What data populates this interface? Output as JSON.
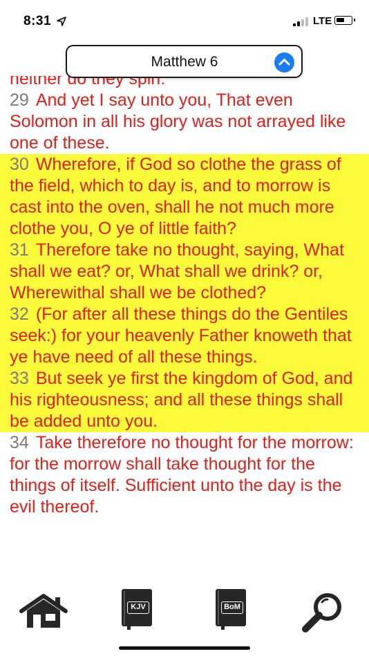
{
  "status_bar": {
    "time": "8:31",
    "network": "LTE"
  },
  "header": {
    "chapter": "Matthew 6"
  },
  "verses": [
    {
      "num": "",
      "text": "neither do they spin:",
      "highlighted": false
    },
    {
      "num": "29",
      "text": "And yet I say unto you, That even Solomon in all his glory was not arrayed like one of these.",
      "highlighted": false
    },
    {
      "num": "30",
      "text": "Wherefore, if God so clothe the grass of the field, which to day is, and to morrow is cast into the oven, shall he not much more clothe you, O ye of little faith?",
      "highlighted": true
    },
    {
      "num": "31",
      "text": "Therefore take no thought, saying, What shall we eat? or, What shall we drink? or, Wherewithal shall we be clothed?",
      "highlighted": true
    },
    {
      "num": "32",
      "text": "(For after all these things do the Gentiles seek:) for your heavenly Father knoweth that ye have need of all these things.",
      "highlighted": true
    },
    {
      "num": "33",
      "text": "But seek ye first the kingdom of God, and his righteousness; and all these things shall be added unto you.",
      "highlighted": true
    },
    {
      "num": "34",
      "text": "Take therefore no thought for the morrow: for the morrow shall take thought for the things of itself. Sufficient unto the day is the evil thereof.",
      "highlighted": false
    }
  ],
  "tab_bar": {
    "home_icon": "home-icon",
    "kjv_label": "KJV",
    "bom_label": "BoM",
    "search_icon": "magnifier-icon"
  },
  "colors": {
    "verse_text": "#e0201b",
    "verse_number": "#7a7a7a",
    "highlight": "#fbfb3c",
    "accent": "#1b7cf2"
  }
}
